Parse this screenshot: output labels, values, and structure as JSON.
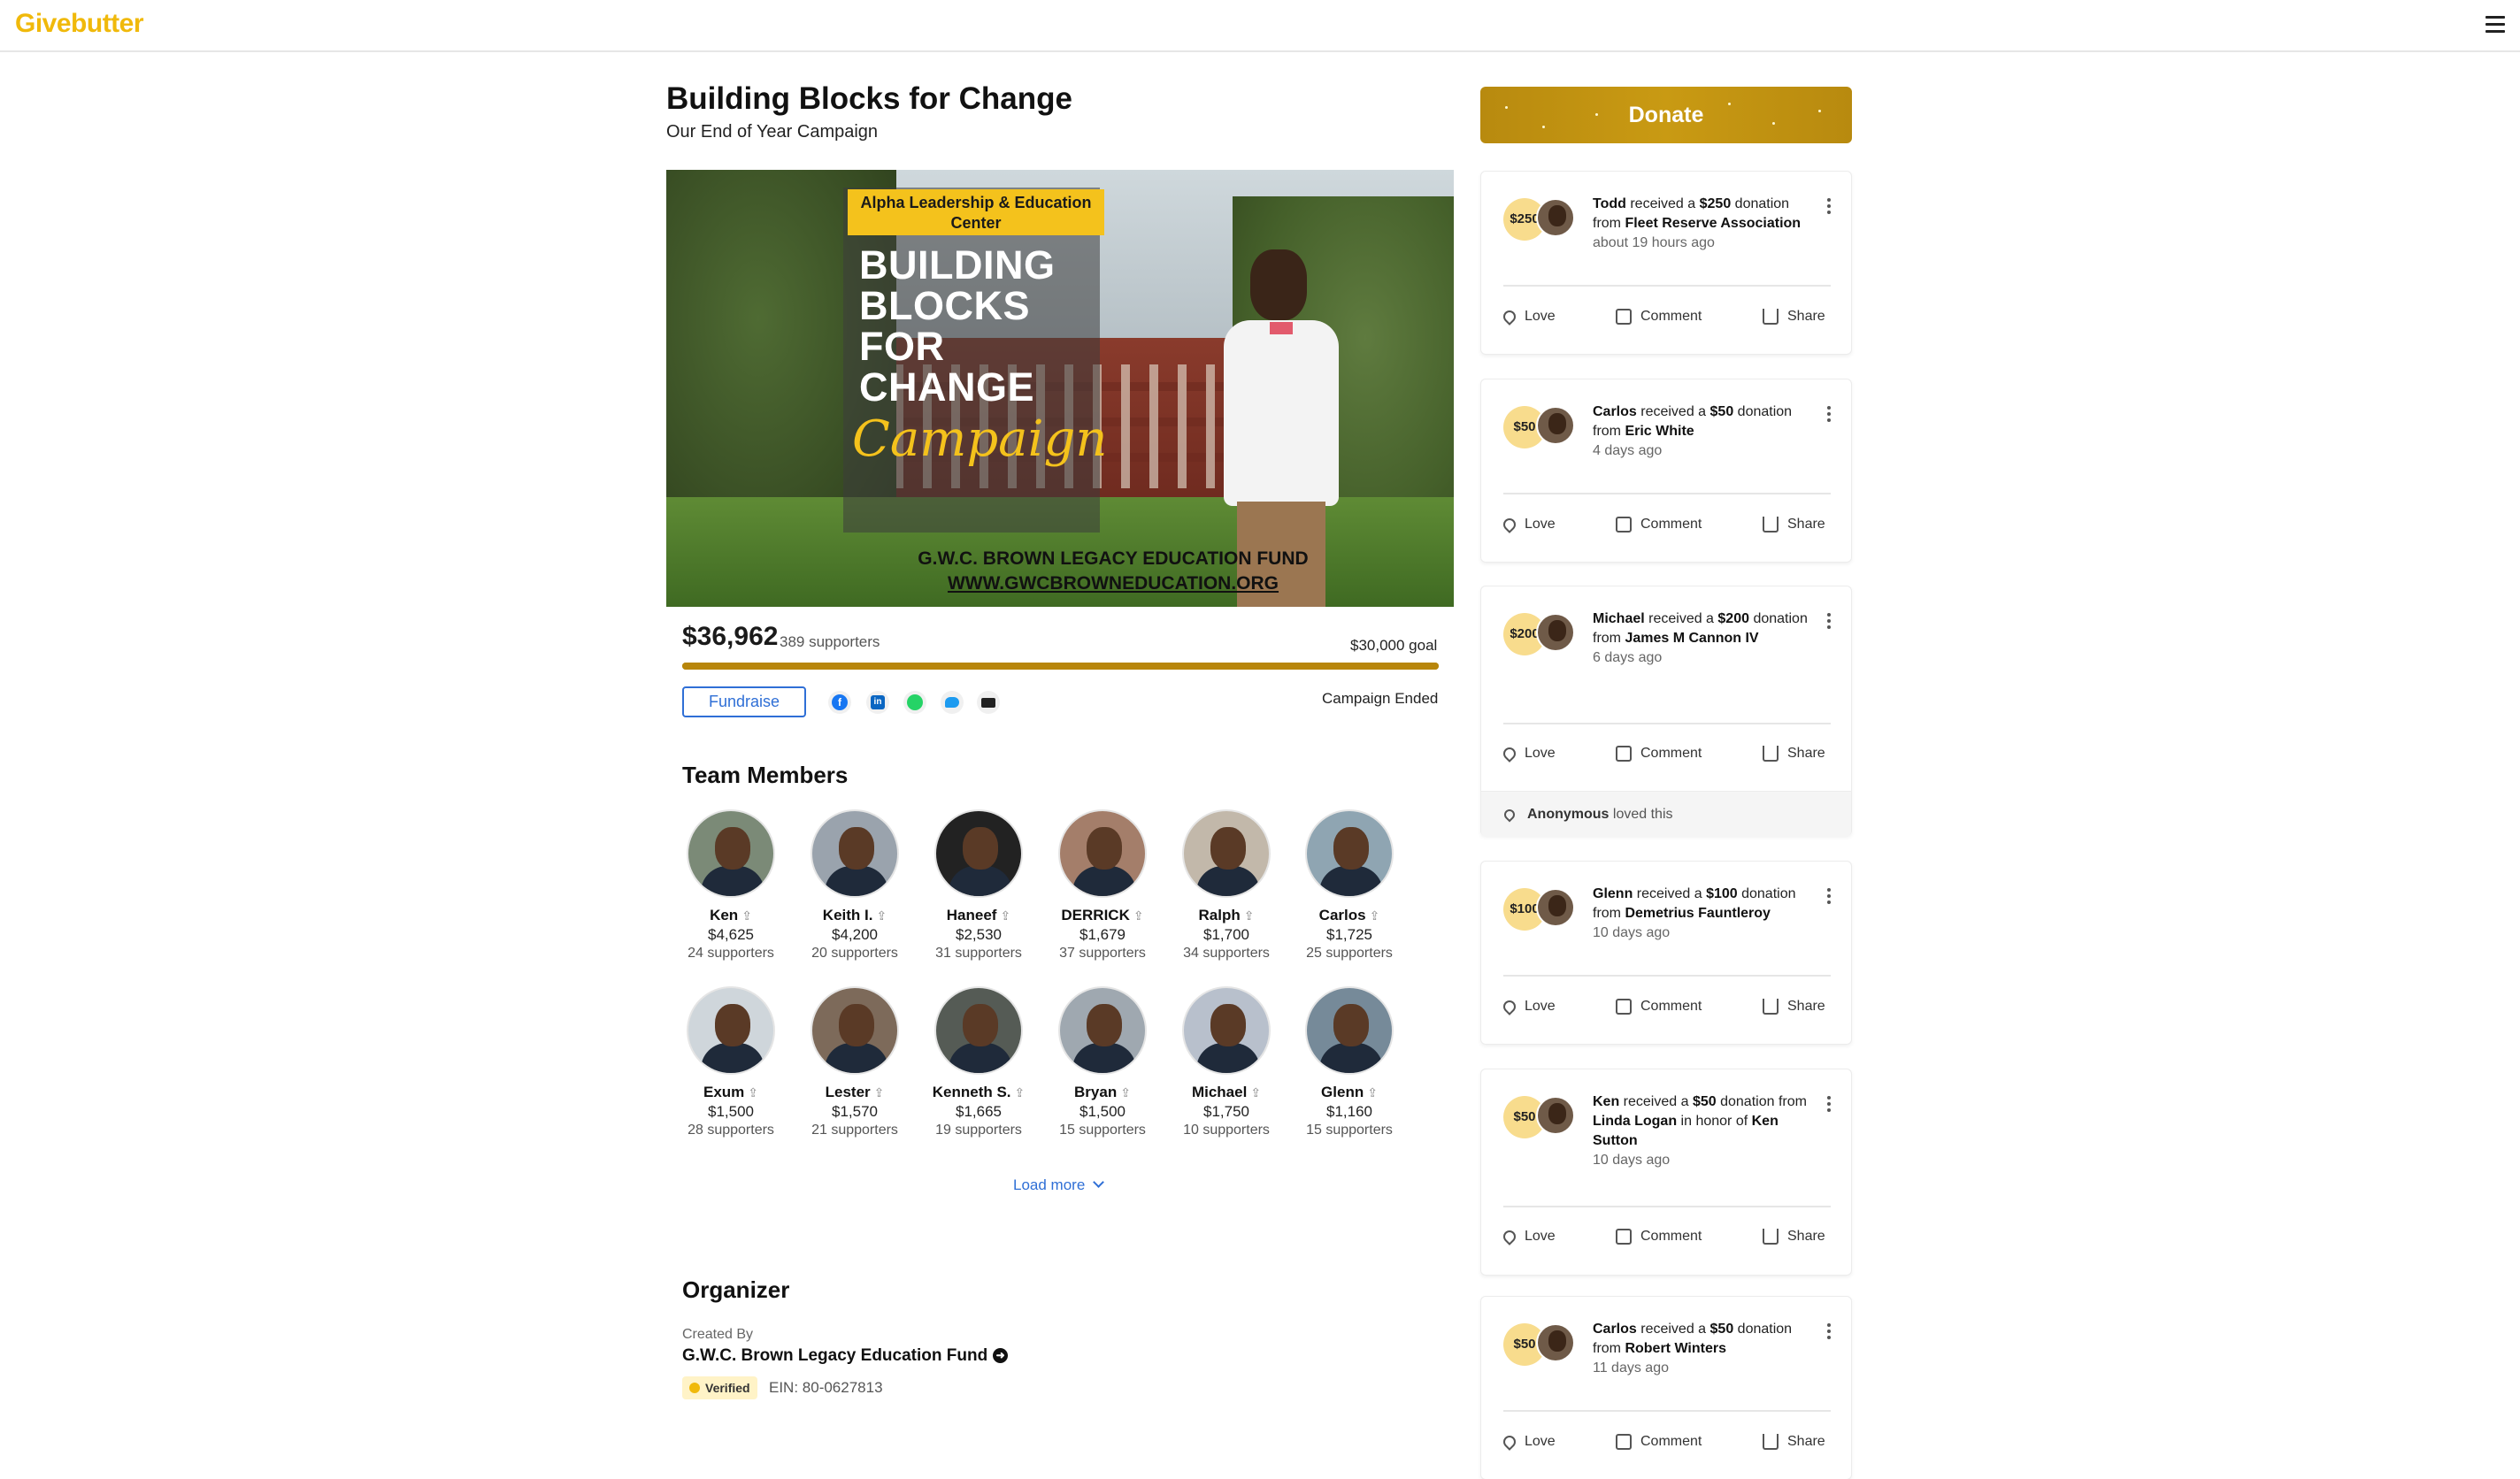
{
  "brand": {
    "logo": "Givebutter",
    "accent": "#f0b90b",
    "donate_color": "#bf9112",
    "link_color": "#2f6fd6"
  },
  "header": {
    "menu_icon": "hamburger-menu-icon"
  },
  "campaign": {
    "title": "Building Blocks for Change",
    "subtitle": "Our End of Year Campaign",
    "hero": {
      "ribbon": "Alpha Leadership & Education Center",
      "headline": [
        "BUILDING",
        "BLOCKS",
        "FOR",
        "CHANGE"
      ],
      "script": "Campaign",
      "fund_name": "G.W.C. BROWN LEGACY EDUCATION FUND",
      "fund_url": "WWW.GWCBROWNEDUCATION.ORG"
    },
    "raised": "$36,962",
    "supporters": "389 supporters",
    "goal": "$30,000 goal",
    "progress_fraction": 1.0,
    "fundraise_label": "Fundraise",
    "share_icons": [
      "facebook-icon",
      "linkedin-icon",
      "whatsapp-icon",
      "twitter-icon",
      "email-icon"
    ],
    "status": "Campaign Ended"
  },
  "team": {
    "heading": "Team Members",
    "members": [
      {
        "name": "Ken",
        "amount": "$4,625",
        "supporters": "24 supporters"
      },
      {
        "name": "Keith I.",
        "amount": "$4,200",
        "supporters": "20 supporters"
      },
      {
        "name": "Haneef",
        "amount": "$2,530",
        "supporters": "31 supporters"
      },
      {
        "name": "DERRICK",
        "amount": "$1,679",
        "supporters": "37 supporters"
      },
      {
        "name": "Ralph",
        "amount": "$1,700",
        "supporters": "34 supporters"
      },
      {
        "name": "Carlos",
        "amount": "$1,725",
        "supporters": "25 supporters"
      },
      {
        "name": "Exum",
        "amount": "$1,500",
        "supporters": "28 supporters"
      },
      {
        "name": "Lester",
        "amount": "$1,570",
        "supporters": "21 supporters"
      },
      {
        "name": "Kenneth S.",
        "amount": "$1,665",
        "supporters": "19 supporters"
      },
      {
        "name": "Bryan",
        "amount": "$1,500",
        "supporters": "15 supporters"
      },
      {
        "name": "Michael",
        "amount": "$1,750",
        "supporters": "10 supporters"
      },
      {
        "name": "Glenn",
        "amount": "$1,160",
        "supporters": "15 supporters"
      }
    ],
    "load_more": "Load more"
  },
  "organizer": {
    "heading": "Organizer",
    "created_by_label": "Created By",
    "name": "G.W.C. Brown Legacy Education Fund",
    "verified": "Verified",
    "ein": "EIN: 80-0627813"
  },
  "sidebar": {
    "donate_label": "Donate",
    "actions": {
      "love": "Love",
      "comment": "Comment",
      "share": "Share"
    },
    "feed": [
      {
        "amount": "$250",
        "recipient": "Todd",
        "mid": " received a ",
        "amt_text": "$250",
        "tail": " donation from ",
        "donor": "Fleet Reserve Association",
        "extra": "",
        "honoree": "",
        "ago": "about 19 hours ago"
      },
      {
        "amount": "$50",
        "recipient": "Carlos",
        "mid": " received a ",
        "amt_text": "$50",
        "tail": " donation from ",
        "donor": "Eric White",
        "extra": "",
        "honoree": "",
        "ago": "4 days ago"
      },
      {
        "amount": "$200",
        "recipient": "Michael",
        "mid": " received a ",
        "amt_text": "$200",
        "tail": " donation from ",
        "donor": "James M Cannon IV",
        "extra": "",
        "honoree": "",
        "ago": "6 days ago",
        "loved_by": "Anonymous",
        "loved_text": " loved this"
      },
      {
        "amount": "$100",
        "recipient": "Glenn",
        "mid": " received a ",
        "amt_text": "$100",
        "tail": " donation from ",
        "donor": "Demetrius Fauntleroy",
        "extra": "",
        "honoree": "",
        "ago": "10 days ago"
      },
      {
        "amount": "$50",
        "recipient": "Ken",
        "mid": " received a ",
        "amt_text": "$50",
        "tail": " donation from ",
        "donor": "Linda Logan",
        "extra": " in honor of ",
        "honoree": "Ken Sutton",
        "ago": "10 days ago"
      },
      {
        "amount": "$50",
        "recipient": "Carlos",
        "mid": " received a ",
        "amt_text": "$50",
        "tail": " donation from ",
        "donor": "Robert Winters",
        "extra": "",
        "honoree": "",
        "ago": "11 days ago"
      }
    ]
  }
}
